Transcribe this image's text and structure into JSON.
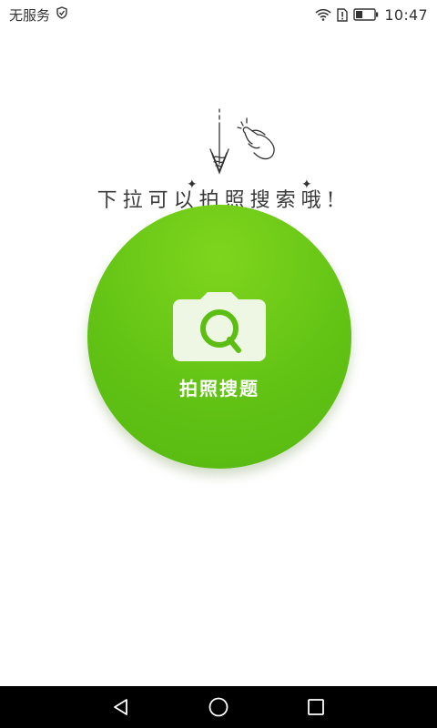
{
  "status_bar": {
    "carrier": "无服务",
    "time": "10:47",
    "icons": [
      "shield-icon",
      "wifi-icon",
      "sim-alert-icon",
      "battery-icon"
    ]
  },
  "hint": {
    "text": "下拉可以拍照搜索哦!",
    "icons": [
      "pull-down-arrow-icon",
      "finger-swipe-icon",
      "sparkle-icon"
    ]
  },
  "camera_button": {
    "label": "拍照搜题",
    "icon": "camera-search-icon"
  },
  "nav_bar": {
    "icons": [
      "back-icon",
      "home-icon",
      "recents-icon"
    ]
  },
  "colors": {
    "accent": "#6cc918",
    "nav_background": "#000000",
    "text": "#333333"
  }
}
